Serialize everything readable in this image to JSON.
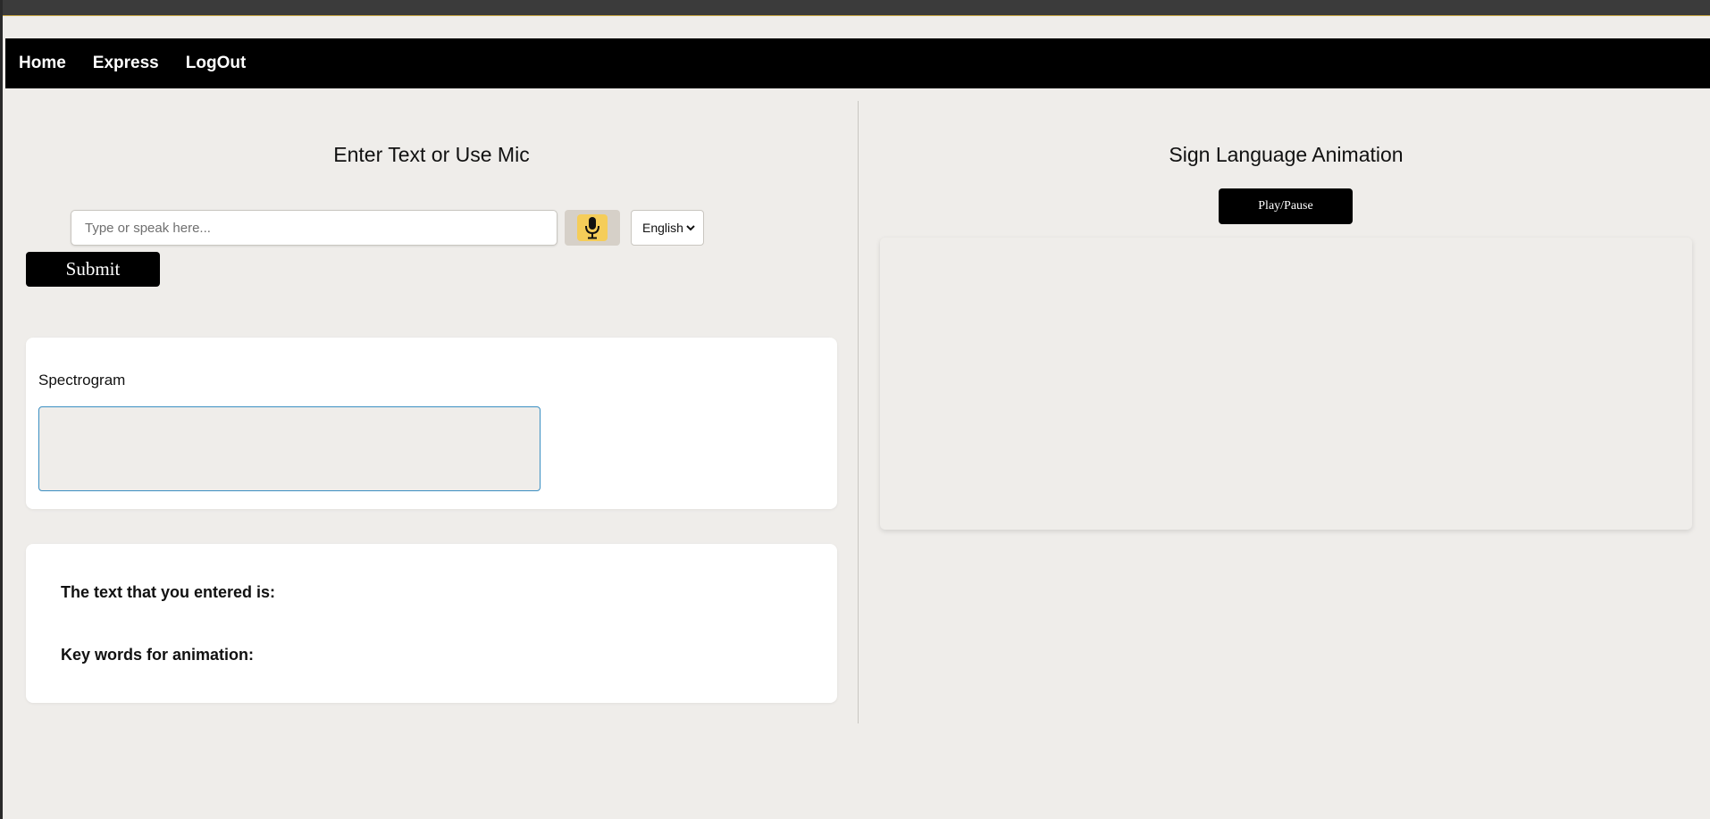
{
  "nav": {
    "items": [
      {
        "label": "Home"
      },
      {
        "label": "Express"
      },
      {
        "label": "LogOut"
      }
    ]
  },
  "left": {
    "heading": "Enter Text or Use Mic",
    "input": {
      "value": "",
      "placeholder": "Type or speak here..."
    },
    "mic_icon": "microphone-icon",
    "language": {
      "selected": "English"
    },
    "submit_label": "Submit",
    "spectrogram": {
      "label": "Spectrogram"
    },
    "result": {
      "entered_label": "The text that you entered is:",
      "keywords_label": "Key words for animation:"
    }
  },
  "right": {
    "heading": "Sign Language Animation",
    "play_pause_label": "Play/Pause"
  },
  "colors": {
    "page_bg": "#efedea",
    "nav_bg": "#000000",
    "mic_accent": "#f5cd59",
    "spectrogram_border": "#3b8fc2"
  }
}
